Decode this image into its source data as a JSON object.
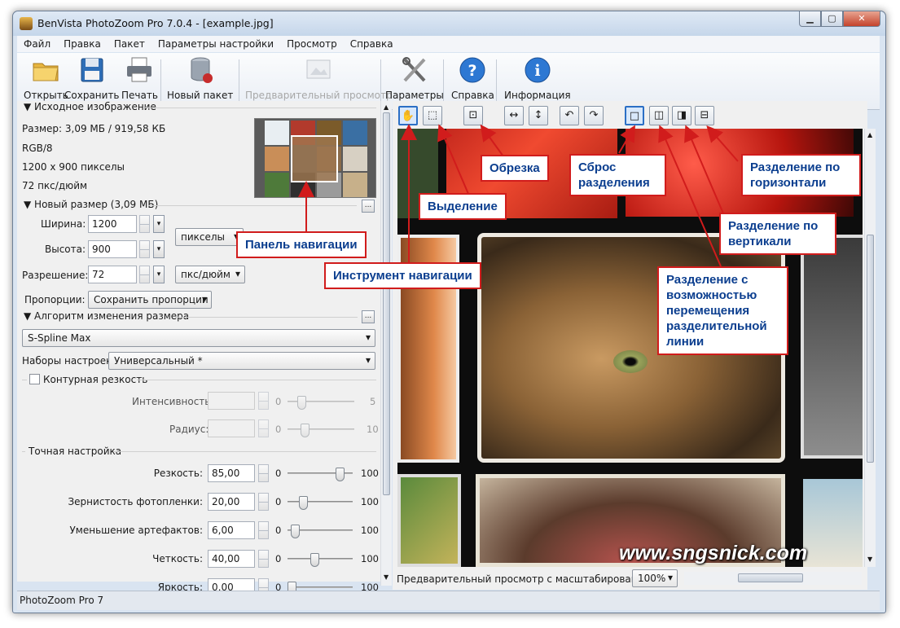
{
  "window": {
    "title": "BenVista PhotoZoom Pro 7.0.4 - [example.jpg]"
  },
  "menu": [
    "Файл",
    "Правка",
    "Пакет",
    "Параметры настройки",
    "Просмотр",
    "Справка"
  ],
  "toolbar": {
    "open": "Открыть",
    "save": "Сохранить",
    "print": "Печать",
    "new_batch": "Новый пакет",
    "preview": "Предварительный просмотр",
    "settings": "Параметры",
    "help": "Справка",
    "info": "Информация"
  },
  "source": {
    "header": "Исходное изображение",
    "size": "Размер: 3,09 МБ / 919,58 КБ",
    "mode": "RGB/8",
    "dims": "1200 x 900 пикселы",
    "dpi": "72 пкс/дюйм"
  },
  "newsize": {
    "header": "Новый размер (3,09 МБ)",
    "width_label": "Ширина:",
    "width_value": "1200",
    "height_label": "Высота:",
    "height_value": "900",
    "res_label": "Разрешение:",
    "res_value": "72",
    "unit": "пикселы",
    "res_unit": "пкс/дюйм",
    "prop_label": "Пропорции:",
    "prop_value": "Сохранить пропорции",
    "more": "..."
  },
  "algorithm": {
    "header": "Алгоритм изменения размера",
    "value": "S-Spline Max",
    "presets_label": "Наборы настроек:",
    "presets_value": "Универсальный *"
  },
  "contour": {
    "label": "Контурная резкость",
    "intensity_label": "Интенсивность:",
    "intensity_min": "0",
    "intensity_max": "5",
    "radius_label": "Радиус:",
    "radius_min": "0",
    "radius_max": "10"
  },
  "fine": {
    "header": "Точная настройка",
    "rows": [
      {
        "label": "Резкость:",
        "value": "85,00",
        "min": "0",
        "max": "100",
        "level": 0.85
      },
      {
        "label": "Зернистость фотопленки:",
        "value": "20,00",
        "min": "0",
        "max": "100",
        "level": 0.2
      },
      {
        "label": "Уменьшение артефактов:",
        "value": "6,00",
        "min": "0",
        "max": "100",
        "level": 0.06
      },
      {
        "label": "Четкость:",
        "value": "40,00",
        "min": "0",
        "max": "100",
        "level": 0.4
      },
      {
        "label": "Яркость:",
        "value": "0,00",
        "min": "0",
        "max": "100",
        "level": 0.0
      }
    ]
  },
  "preview": {
    "zoom_label": "Предварительный просмотр с масштабированием:",
    "zoom_value": "100%"
  },
  "status": "PhotoZoom Pro 7",
  "callouts": {
    "nav_panel": "Панель навигации",
    "nav_tool": "Инструмент навигации",
    "selection": "Выделение",
    "crop": "Обрезка",
    "reset_split": "Сброс разделения",
    "split_h": "Разделение по горизонтали",
    "split_v": "Разделение по вертикали",
    "split_move": "Разделение с возможностью перемещения разделительной линии"
  },
  "watermark": "www.sngsnick.com",
  "colors": {
    "callout_border": "#d11c1c",
    "callout_text": "#0b3e8f",
    "accent": "#2b6fc5"
  }
}
